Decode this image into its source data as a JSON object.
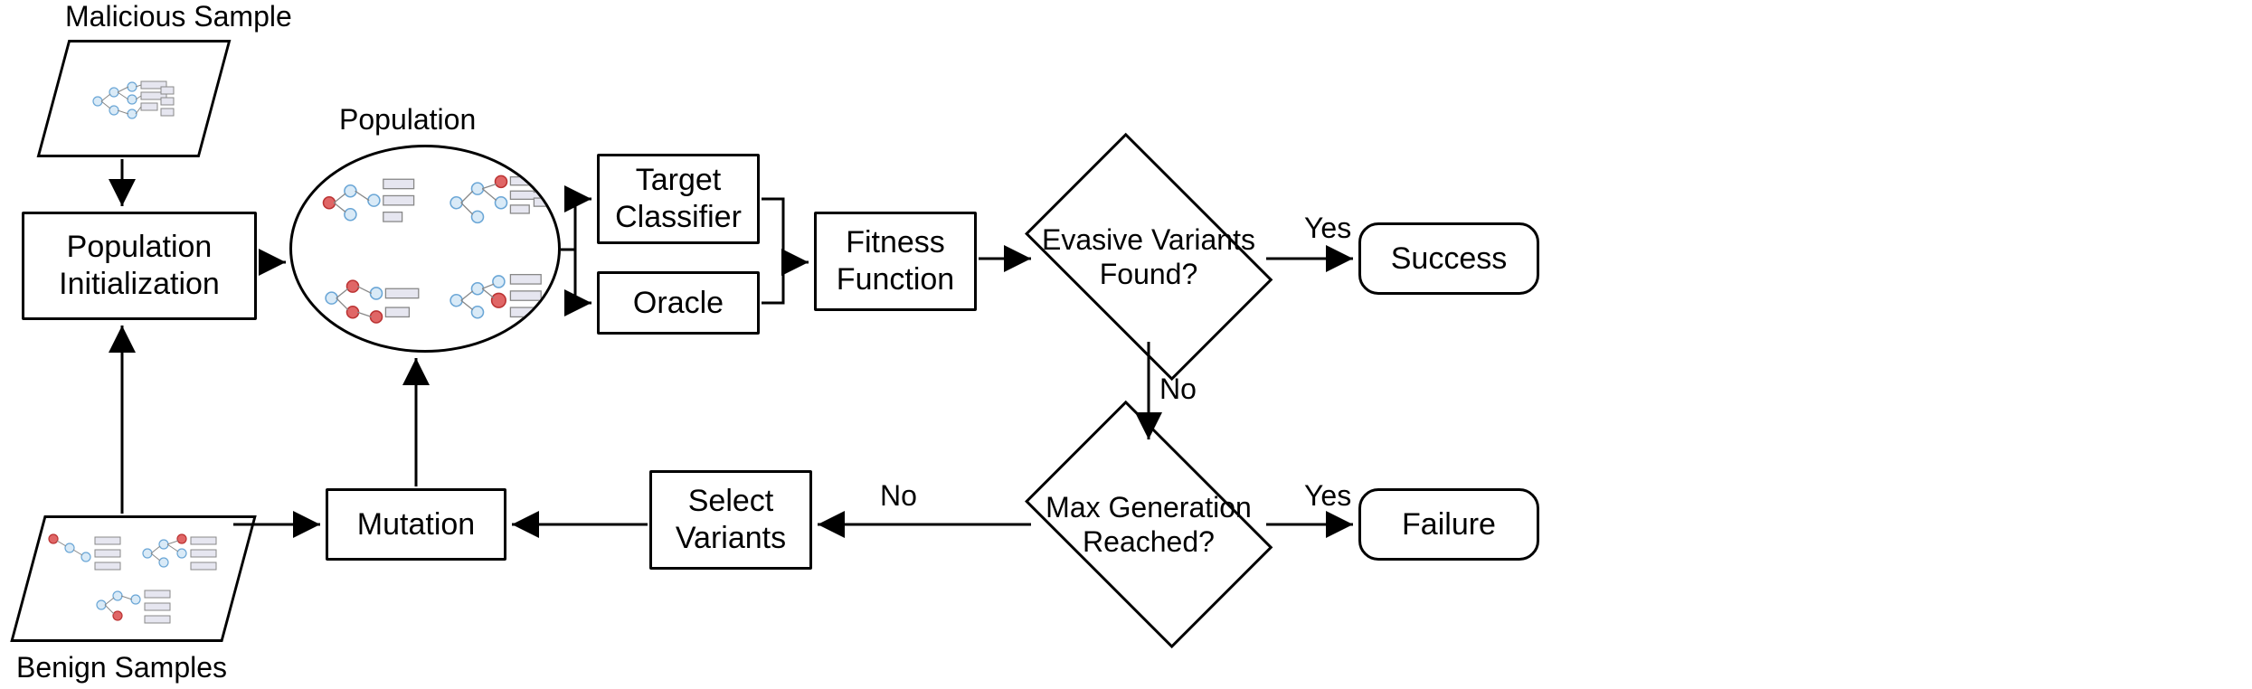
{
  "labels": {
    "malicious": "Malicious Sample",
    "benign": "Benign Samples",
    "population": "Population"
  },
  "boxes": {
    "init": "Population\nInitialization",
    "target": "Target\nClassifier",
    "oracle": "Oracle",
    "fitness": "Fitness\nFunction",
    "mutation": "Mutation",
    "select": "Select\nVariants",
    "success": "Success",
    "failure": "Failure"
  },
  "decisions": {
    "evasive": "Evasive Variants\nFound?",
    "maxgen": "Max Generation\nReached?"
  },
  "edges": {
    "yes": "Yes",
    "no": "No"
  }
}
